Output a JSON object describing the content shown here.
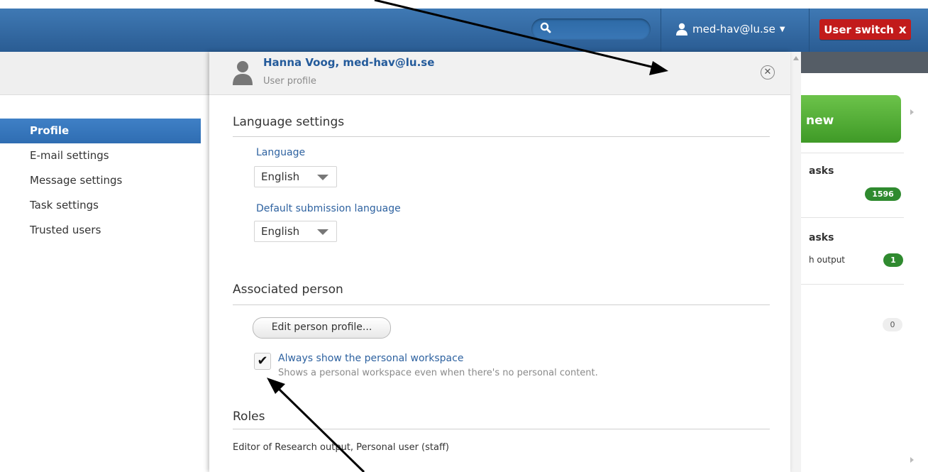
{
  "topbar": {
    "search_placeholder": "",
    "user_label": "med-hav@lu.se",
    "user_switch_label": "User switch",
    "user_switch_close": "x"
  },
  "sidebar": {
    "items": [
      {
        "label": "Profile",
        "active": true
      },
      {
        "label": "E-mail settings"
      },
      {
        "label": "Message settings"
      },
      {
        "label": "Task settings"
      },
      {
        "label": "Trusted users"
      }
    ]
  },
  "modal": {
    "title": "Hanna Voog, med-hav@lu.se",
    "subtitle": "User profile",
    "language_section": "Language settings",
    "language_label": "Language",
    "language_value": "English",
    "submission_label": "Default submission language",
    "submission_value": "English",
    "person_section": "Associated person",
    "edit_person_button": "Edit person profile...",
    "workspace_checked": true,
    "workspace_label": "Always show the personal workspace",
    "workspace_desc": "Shows a personal workspace even when there's no personal content.",
    "roles_section": "Roles",
    "roles_text": "Editor of Research output, Personal user (staff)"
  },
  "dashboard": {
    "new_button": "new",
    "tasks_heading_1": "asks",
    "tasks_count_1": "1596",
    "tasks_heading_2": "asks",
    "tasks_item_2": "h output",
    "tasks_count_2": "1",
    "count_3": "0"
  },
  "colors": {
    "topbar": "#2f65a0",
    "user_switch": "#c21b1b",
    "active_nav": "#3475bb",
    "green_button": "#4fab30",
    "badge_green": "#2f8a2f"
  }
}
